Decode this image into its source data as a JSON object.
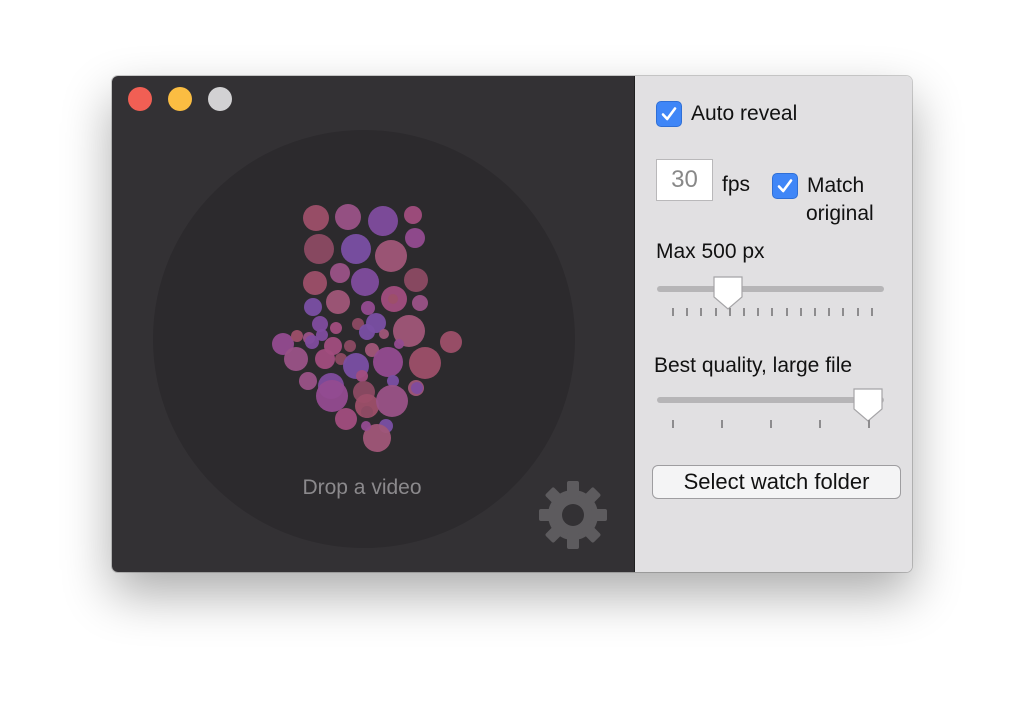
{
  "colors": {
    "close": "#f15f54",
    "minimize": "#fbbd42",
    "zoom": "#d2d1d3",
    "checkbox_accent": "#3f86f7",
    "drop_panel": "#333134",
    "settings_panel": "#e1e0e2"
  },
  "titlebar": {
    "buttons": [
      "close",
      "minimize",
      "zoom"
    ]
  },
  "drop": {
    "label": "Drop a video",
    "icon": "down-arrow-bubbles-icon"
  },
  "settings_icon": "gear-icon",
  "options": {
    "auto_reveal": {
      "label": "Auto reveal",
      "checked": true
    },
    "fps": {
      "value": "30",
      "unit": "fps"
    },
    "match_original": {
      "label_line1": "Match",
      "label_line2": "original",
      "checked": true
    },
    "max_size": {
      "label": "Max 500 px",
      "level_fraction": 0.31
    },
    "quality": {
      "label": "Best quality, large file",
      "level_fraction": 1.0
    },
    "watch_folder_button": "Select watch folder"
  }
}
